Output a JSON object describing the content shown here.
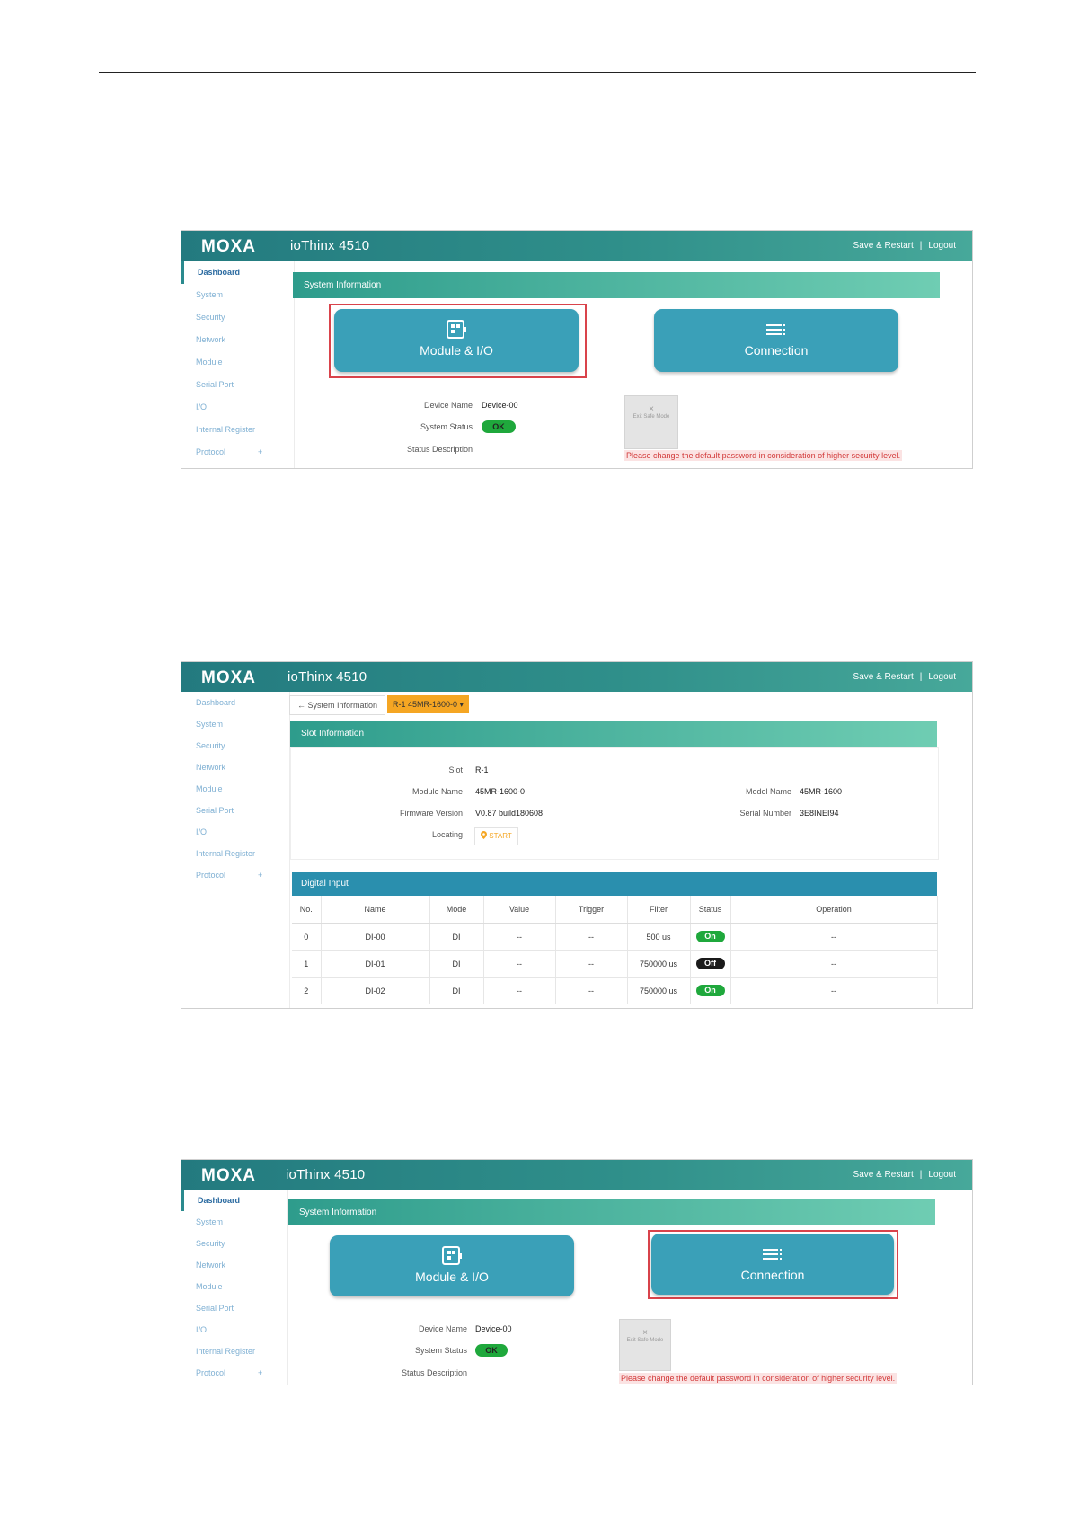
{
  "brand": {
    "logo_text": "MOXA",
    "app_title": "ioThinx 4510",
    "save_restart": "Save & Restart",
    "separator": "|",
    "logout": "Logout"
  },
  "sidebar": {
    "items": [
      {
        "label": "Dashboard"
      },
      {
        "label": "System"
      },
      {
        "label": "Security"
      },
      {
        "label": "Network"
      },
      {
        "label": "Module"
      },
      {
        "label": "Serial Port"
      },
      {
        "label": "I/O"
      },
      {
        "label": "Internal Register"
      },
      {
        "label": "Protocol"
      }
    ],
    "expand_glyph": "+"
  },
  "dashboard": {
    "panel_title": "System Information",
    "module_button": "Module & I/O",
    "connection_button": "Connection",
    "device_name_label": "Device Name",
    "device_name_value": "Device-00",
    "system_status_label": "System Status",
    "system_status_value": "OK",
    "status_description_label": "Status Description",
    "failsafe_label": "Exit Safe Mode",
    "failsafe_glyph": "×",
    "warning": "Please change the default password in consideration of higher security level."
  },
  "slot_page": {
    "back_tab": "← System Information",
    "slot_selector": "R-1 45MR-1600-0 ▾",
    "slot_panel_title": "Slot Information",
    "slot_label": "Slot",
    "slot_value": "R-1",
    "module_name_label": "Module Name",
    "module_name_value": "45MR-1600-0",
    "firmware_label": "Firmware Version",
    "firmware_value": "V0.87 build180608",
    "locating_label": "Locating",
    "locating_button": "START",
    "model_name_label": "Model Name",
    "model_name_value": "45MR-1600",
    "serial_label": "Serial Number",
    "serial_value": "3E8INEI94",
    "di_title": "Digital Input",
    "columns": [
      "No.",
      "Name",
      "Mode",
      "Value",
      "Trigger",
      "Filter",
      "Status",
      "Operation"
    ],
    "rows": [
      {
        "no": "0",
        "name": "DI-00",
        "mode": "DI",
        "value": "--",
        "trigger": "--",
        "filter": "500 us",
        "status": "On",
        "operation": "--"
      },
      {
        "no": "1",
        "name": "DI-01",
        "mode": "DI",
        "value": "--",
        "trigger": "--",
        "filter": "750000 us",
        "status": "Off",
        "operation": "--"
      },
      {
        "no": "2",
        "name": "DI-02",
        "mode": "DI",
        "value": "--",
        "trigger": "--",
        "filter": "750000 us",
        "status": "On",
        "operation": "--"
      }
    ]
  },
  "colors": {
    "topbar": "#2f8f8a",
    "button": "#3aa0b8",
    "highlight": "#d9434b",
    "ok": "#1fa83c",
    "locating": "#f5a623"
  }
}
